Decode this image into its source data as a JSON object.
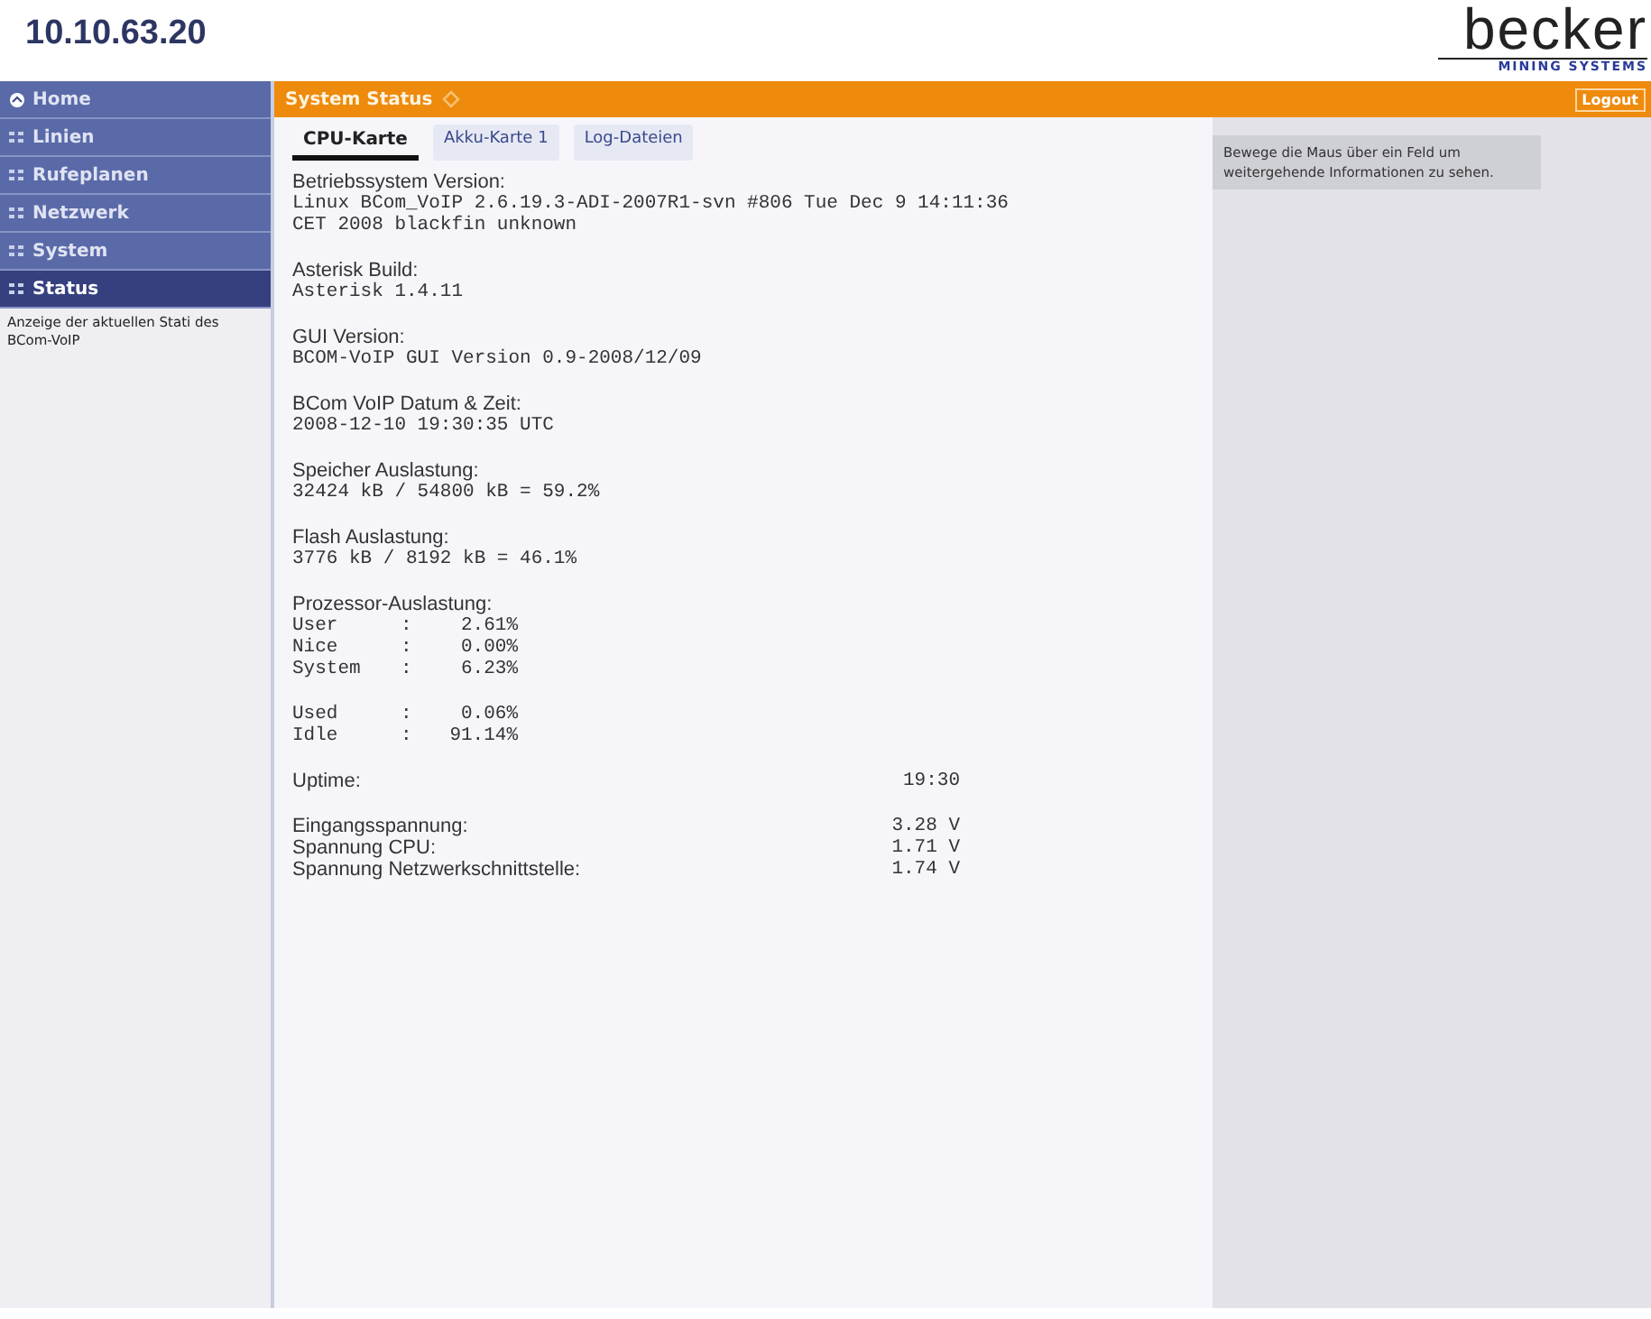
{
  "header": {
    "title": "10.10.63.20",
    "logo": {
      "name": "becker",
      "tagline": "MINING SYSTEMS"
    }
  },
  "sidebar": {
    "items": [
      {
        "label": "Home",
        "kind": "home",
        "selected": false
      },
      {
        "label": "Linien",
        "kind": "section",
        "selected": false
      },
      {
        "label": "Rufeplanen",
        "kind": "section",
        "selected": false
      },
      {
        "label": "Netzwerk",
        "kind": "section",
        "selected": false
      },
      {
        "label": "System",
        "kind": "section",
        "selected": false
      },
      {
        "label": "Status",
        "kind": "section",
        "selected": true
      }
    ],
    "description": "Anzeige der aktuellen Stati des BCom-VoIP"
  },
  "topbar": {
    "title": "System Status",
    "logout": "Logout"
  },
  "tabs": [
    {
      "label": "CPU-Karte",
      "selected": true
    },
    {
      "label": "Akku-Karte 1",
      "selected": false
    },
    {
      "label": "Log-Dateien",
      "selected": false
    }
  ],
  "sections": [
    {
      "kind": "block",
      "label": "Betriebssystem Version:",
      "lines": [
        "Linux BCom_VoIP 2.6.19.3-ADI-2007R1-svn #806 Tue Dec 9 14:11:36",
        "CET 2008 blackfin unknown"
      ]
    },
    {
      "kind": "block",
      "label": "Asterisk Build:",
      "lines": [
        "Asterisk 1.4.11"
      ]
    },
    {
      "kind": "block",
      "label": "GUI Version:",
      "lines": [
        "BCOM-VoIP GUI Version 0.9-2008/12/09"
      ]
    },
    {
      "kind": "block",
      "label": "BCom VoIP Datum & Zeit:",
      "lines": [
        "2008-12-10 19:30:35 UTC"
      ]
    },
    {
      "kind": "block",
      "label": "Speicher Auslastung:",
      "lines": [
        "32424 kB / 54800 kB = 59.2%"
      ]
    },
    {
      "kind": "block",
      "label": "Flash Auslastung:",
      "lines": [
        "3776 kB / 8192 kB = 46.1%"
      ]
    },
    {
      "kind": "stats",
      "label": "Prozessor-Auslastung:",
      "rows": [
        {
          "name": "User",
          "sep": ":",
          "value": "2.61%"
        },
        {
          "name": "Nice",
          "sep": ":",
          "value": "0.00%"
        },
        {
          "name": "System",
          "sep": ":",
          "value": "6.23%"
        }
      ]
    },
    {
      "kind": "stats",
      "rows": [
        {
          "name": "Used",
          "sep": ":",
          "value": "0.06%"
        },
        {
          "name": "Idle",
          "sep": ":",
          "value": "91.14%"
        }
      ]
    },
    {
      "kind": "pairs",
      "rows": [
        {
          "label": "Uptime:",
          "value": "19:30"
        }
      ]
    },
    {
      "kind": "pairs",
      "rows": [
        {
          "label": "Eingangsspannung:",
          "value": "3.28 V"
        },
        {
          "label": "Spannung CPU:",
          "value": "1.71 V"
        },
        {
          "label": "Spannung Netzwerkschnittstelle:",
          "value": "1.74 V"
        }
      ]
    }
  ],
  "help": {
    "text": "Bewege die Maus über ein Feld um weitergehende Informationen zu sehen."
  }
}
